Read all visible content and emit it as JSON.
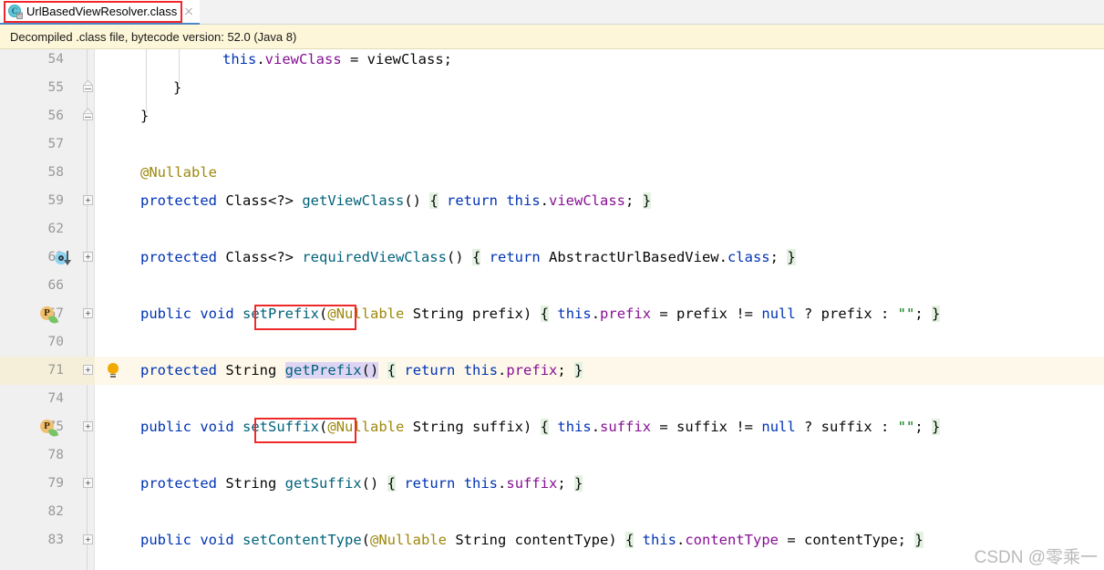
{
  "tab": {
    "title": "UrlBasedViewResolver.class",
    "icon": "java-class-icon",
    "icon_letter": "C",
    "close_icon": "close-icon"
  },
  "notification": {
    "text": "Decompiled .class file, bytecode version: 52.0 (Java 8)"
  },
  "colors": {
    "keyword": "#0033b3",
    "annotation": "#9e880d",
    "field": "#871094",
    "method": "#00627a",
    "string": "#067d17",
    "brace_match_bg": "#e3f2e1",
    "identifier_hl_bg": "#ded5f5",
    "current_line_bg": "#fdf8e9",
    "gutter_bg": "#f0f0f0",
    "notification_bg": "#fdf6d8",
    "annotation_box": "#ef2929",
    "tab_underline": "#4a86c8"
  },
  "editor": {
    "lines": [
      {
        "num": "54",
        "indent": 90,
        "tokens": [
          {
            "t": "this",
            "c": "kw"
          },
          {
            "t": ".",
            "c": "plain"
          },
          {
            "t": "viewClass",
            "c": "field"
          },
          {
            "t": " = viewClass;",
            "c": "plain"
          }
        ]
      },
      {
        "num": "55",
        "indent": 36,
        "tokens": [
          {
            "t": "}",
            "c": "plain"
          }
        ]
      },
      {
        "num": "56",
        "indent": 0,
        "tokens": [
          {
            "t": "}",
            "c": "plain"
          }
        ]
      },
      {
        "num": "57",
        "indent": 0,
        "tokens": []
      },
      {
        "num": "58",
        "indent": 0,
        "tokens": [
          {
            "t": "@Nullable",
            "c": "anno"
          }
        ]
      },
      {
        "num": "59",
        "indent": 0,
        "tokens": [
          {
            "t": "protected",
            "c": "kw"
          },
          {
            "t": " Class<?> ",
            "c": "plain"
          },
          {
            "t": "getViewClass",
            "c": "method"
          },
          {
            "t": "() ",
            "c": "plain"
          },
          {
            "t": "{",
            "c": "brace"
          },
          {
            "t": " ",
            "c": "plain"
          },
          {
            "t": "return",
            "c": "kw"
          },
          {
            "t": " ",
            "c": "plain"
          },
          {
            "t": "this",
            "c": "kw"
          },
          {
            "t": ".",
            "c": "plain"
          },
          {
            "t": "viewClass",
            "c": "field"
          },
          {
            "t": "; ",
            "c": "plain"
          },
          {
            "t": "}",
            "c": "brace"
          }
        ]
      },
      {
        "num": "62",
        "indent": 0,
        "tokens": []
      },
      {
        "num": "63",
        "indent": 0,
        "tokens": [
          {
            "t": "protected",
            "c": "kw"
          },
          {
            "t": " Class<?> ",
            "c": "plain"
          },
          {
            "t": "requiredViewClass",
            "c": "method"
          },
          {
            "t": "() ",
            "c": "plain"
          },
          {
            "t": "{",
            "c": "brace"
          },
          {
            "t": " ",
            "c": "plain"
          },
          {
            "t": "return",
            "c": "kw"
          },
          {
            "t": " AbstractUrlBasedView.",
            "c": "plain"
          },
          {
            "t": "class",
            "c": "kw"
          },
          {
            "t": "; ",
            "c": "plain"
          },
          {
            "t": "}",
            "c": "brace"
          }
        ]
      },
      {
        "num": "66",
        "indent": 0,
        "tokens": []
      },
      {
        "num": "67",
        "indent": 0,
        "tokens": [
          {
            "t": "public",
            "c": "kw"
          },
          {
            "t": " ",
            "c": "plain"
          },
          {
            "t": "void",
            "c": "kw"
          },
          {
            "t": " ",
            "c": "plain"
          },
          {
            "t": "setPrefix",
            "c": "method"
          },
          {
            "t": "(",
            "c": "plain"
          },
          {
            "t": "@Nullable",
            "c": "anno"
          },
          {
            "t": " String prefix) ",
            "c": "plain"
          },
          {
            "t": "{",
            "c": "brace"
          },
          {
            "t": " ",
            "c": "plain"
          },
          {
            "t": "this",
            "c": "kw"
          },
          {
            "t": ".",
            "c": "plain"
          },
          {
            "t": "prefix",
            "c": "field"
          },
          {
            "t": " = prefix != ",
            "c": "plain"
          },
          {
            "t": "null",
            "c": "kw"
          },
          {
            "t": " ? prefix : ",
            "c": "plain"
          },
          {
            "t": "\"\"",
            "c": "str"
          },
          {
            "t": "; ",
            "c": "plain"
          },
          {
            "t": "}",
            "c": "brace"
          }
        ]
      },
      {
        "num": "70",
        "indent": 0,
        "tokens": []
      },
      {
        "num": "71",
        "indent": 0,
        "tokens": [
          {
            "t": "protected",
            "c": "kw"
          },
          {
            "t": " String ",
            "c": "plain"
          },
          {
            "t": "getPrefix",
            "c": "method ident-hl"
          },
          {
            "t": "()",
            "c": "plain ident-hl"
          },
          {
            "t": " ",
            "c": "plain"
          },
          {
            "t": "{",
            "c": "brace"
          },
          {
            "t": " ",
            "c": "plain"
          },
          {
            "t": "return",
            "c": "kw"
          },
          {
            "t": " ",
            "c": "plain"
          },
          {
            "t": "this",
            "c": "kw"
          },
          {
            "t": ".",
            "c": "plain"
          },
          {
            "t": "prefix",
            "c": "field"
          },
          {
            "t": "; ",
            "c": "plain"
          },
          {
            "t": "}",
            "c": "brace"
          }
        ]
      },
      {
        "num": "74",
        "indent": 0,
        "tokens": []
      },
      {
        "num": "75",
        "indent": 0,
        "tokens": [
          {
            "t": "public",
            "c": "kw"
          },
          {
            "t": " ",
            "c": "plain"
          },
          {
            "t": "void",
            "c": "kw"
          },
          {
            "t": " ",
            "c": "plain"
          },
          {
            "t": "setSuffix",
            "c": "method"
          },
          {
            "t": "(",
            "c": "plain"
          },
          {
            "t": "@Nullable",
            "c": "anno"
          },
          {
            "t": " String suffix) ",
            "c": "plain"
          },
          {
            "t": "{",
            "c": "brace"
          },
          {
            "t": " ",
            "c": "plain"
          },
          {
            "t": "this",
            "c": "kw"
          },
          {
            "t": ".",
            "c": "plain"
          },
          {
            "t": "suffix",
            "c": "field"
          },
          {
            "t": " = suffix != ",
            "c": "plain"
          },
          {
            "t": "null",
            "c": "kw"
          },
          {
            "t": " ? suffix : ",
            "c": "plain"
          },
          {
            "t": "\"\"",
            "c": "str"
          },
          {
            "t": "; ",
            "c": "plain"
          },
          {
            "t": "}",
            "c": "brace"
          }
        ]
      },
      {
        "num": "78",
        "indent": 0,
        "tokens": []
      },
      {
        "num": "79",
        "indent": 0,
        "tokens": [
          {
            "t": "protected",
            "c": "kw"
          },
          {
            "t": " String ",
            "c": "plain"
          },
          {
            "t": "getSuffix",
            "c": "method"
          },
          {
            "t": "() ",
            "c": "plain"
          },
          {
            "t": "{",
            "c": "brace"
          },
          {
            "t": " ",
            "c": "plain"
          },
          {
            "t": "return",
            "c": "kw"
          },
          {
            "t": " ",
            "c": "plain"
          },
          {
            "t": "this",
            "c": "kw"
          },
          {
            "t": ".",
            "c": "plain"
          },
          {
            "t": "suffix",
            "c": "field"
          },
          {
            "t": "; ",
            "c": "plain"
          },
          {
            "t": "}",
            "c": "brace"
          }
        ]
      },
      {
        "num": "82",
        "indent": 0,
        "tokens": []
      },
      {
        "num": "83",
        "indent": 0,
        "tokens": [
          {
            "t": "public",
            "c": "kw"
          },
          {
            "t": " ",
            "c": "plain"
          },
          {
            "t": "void",
            "c": "kw"
          },
          {
            "t": " ",
            "c": "plain"
          },
          {
            "t": "setContentType",
            "c": "method"
          },
          {
            "t": "(",
            "c": "plain"
          },
          {
            "t": "@Nullable",
            "c": "anno"
          },
          {
            "t": " String contentType) ",
            "c": "plain"
          },
          {
            "t": "{",
            "c": "brace"
          },
          {
            "t": " ",
            "c": "plain"
          },
          {
            "t": "this",
            "c": "kw"
          },
          {
            "t": ".",
            "c": "plain"
          },
          {
            "t": "contentType",
            "c": "field"
          },
          {
            "t": " = contentType; ",
            "c": "plain"
          },
          {
            "t": "}",
            "c": "brace"
          }
        ]
      }
    ]
  },
  "watermark": {
    "text": "CSDN @零乘一"
  }
}
